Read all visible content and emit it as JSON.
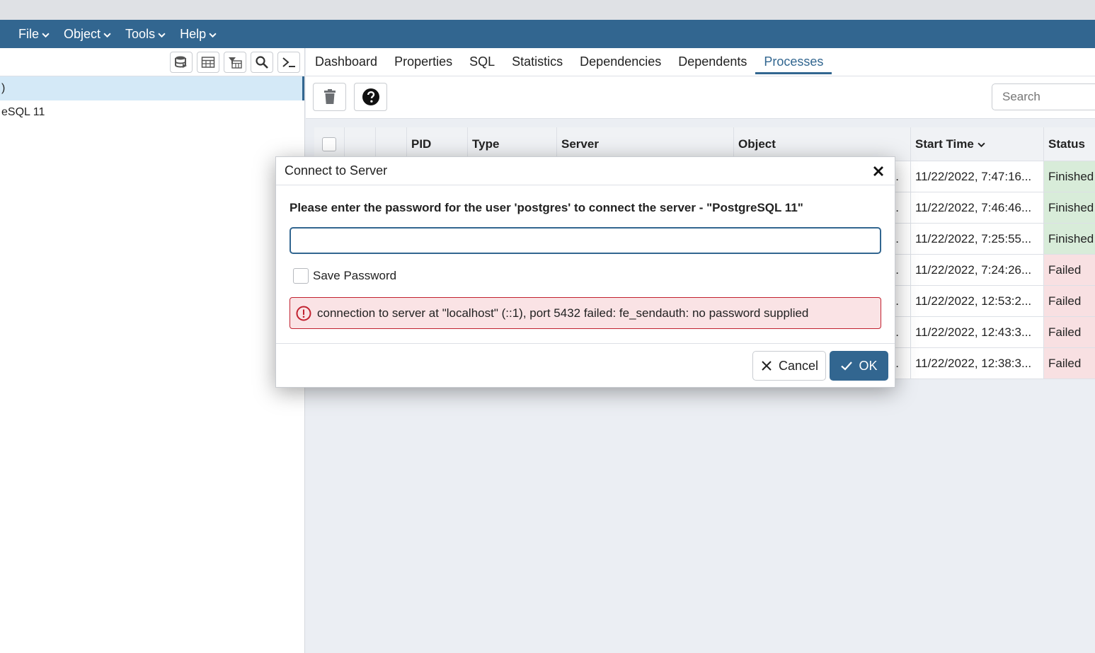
{
  "menu": [
    {
      "label": "File"
    },
    {
      "label": "Object"
    },
    {
      "label": "Tools"
    },
    {
      "label": "Help"
    }
  ],
  "browser": {
    "toolbar_icons": [
      "database-icon",
      "table-icon",
      "filtered-table-icon",
      "search-icon",
      "terminal-icon"
    ],
    "tree": [
      {
        "label": ")",
        "selected": true
      },
      {
        "label": "eSQL 11",
        "selected": false
      }
    ]
  },
  "tabs": [
    {
      "label": "Dashboard",
      "active": false
    },
    {
      "label": "Properties",
      "active": false
    },
    {
      "label": "SQL",
      "active": false
    },
    {
      "label": "Statistics",
      "active": false
    },
    {
      "label": "Dependencies",
      "active": false
    },
    {
      "label": "Dependents",
      "active": false
    },
    {
      "label": "Processes",
      "active": true
    }
  ],
  "processes": {
    "search_placeholder": "Search",
    "columns": [
      "",
      "",
      "",
      "PID",
      "Type",
      "Server",
      "Object",
      "Start Time",
      "Status"
    ],
    "rows": [
      {
        "object": "...",
        "start_time": "11/22/2022, 7:47:16...",
        "status": "Finished"
      },
      {
        "object": "...",
        "start_time": "11/22/2022, 7:46:46...",
        "status": "Finished"
      },
      {
        "object": "...",
        "start_time": "11/22/2022, 7:25:55...",
        "status": "Finished"
      },
      {
        "object": "...",
        "start_time": "11/22/2022, 7:24:26...",
        "status": "Failed"
      },
      {
        "object": "...",
        "start_time": "11/22/2022, 12:53:2...",
        "status": "Failed"
      },
      {
        "object": "...",
        "start_time": "11/22/2022, 12:43:3...",
        "status": "Failed"
      },
      {
        "object": "...",
        "start_time": "11/22/2022, 12:38:3...",
        "status": "Failed"
      }
    ]
  },
  "dialog": {
    "title": "Connect to Server",
    "message": "Please enter the password for the user 'postgres' to connect the server - \"PostgreSQL 11\"",
    "password_value": "",
    "save_password_label": "Save Password",
    "save_password_checked": false,
    "error": "connection to server at \"localhost\" (::1), port 5432 failed: fe_sendauth: no password supplied",
    "cancel_label": "Cancel",
    "ok_label": "OK"
  },
  "colors": {
    "brand": "#326690",
    "finished_bg": "#d8ecd9",
    "failed_bg": "#f8e0e2",
    "error_border": "#c1212f"
  }
}
